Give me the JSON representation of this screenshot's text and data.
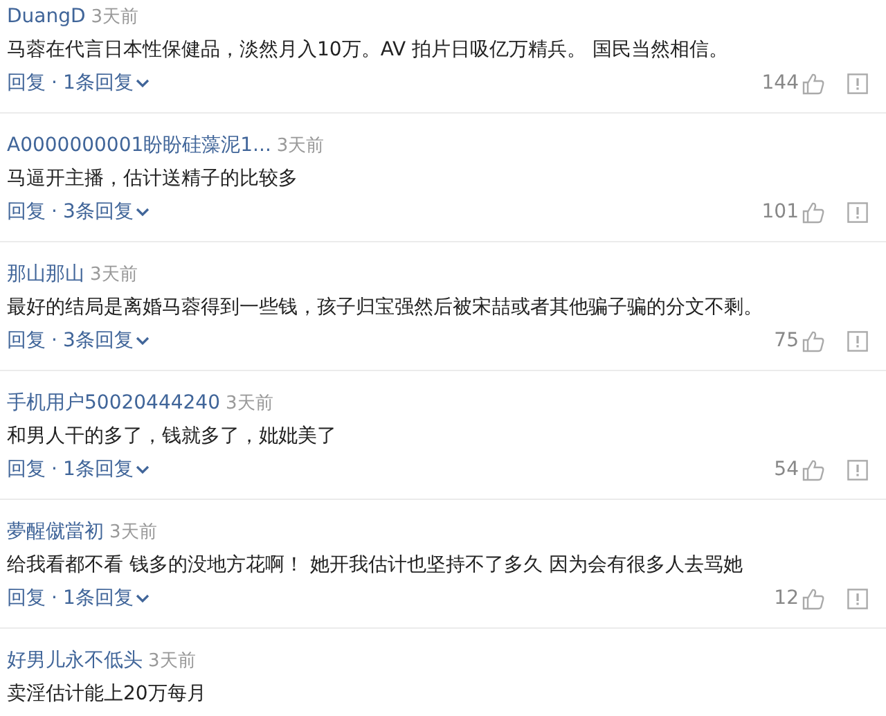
{
  "comments": [
    {
      "author": "DuangD",
      "time": "3天前",
      "text": "马蓉在代言日本性保健品，淡然月入10万。AV 拍片日吸亿万精兵。 国民当然相信。",
      "reply": "回复",
      "separator": "·",
      "replies": "1条回复",
      "likes": "144"
    },
    {
      "author": "A0000000001盼盼硅藻泥1...",
      "time": "3天前",
      "text": "马逼开主播，估计送精子的比较多",
      "reply": "回复",
      "separator": "·",
      "replies": "3条回复",
      "likes": "101"
    },
    {
      "author": "那山那山",
      "time": "3天前",
      "text": "最好的结局是离婚马蓉得到一些钱，孩子归宝强然后被宋喆或者其他骗子骗的分文不剩。",
      "reply": "回复",
      "separator": "·",
      "replies": "3条回复",
      "likes": "75"
    },
    {
      "author": "手机用户50020444240",
      "time": "3天前",
      "text": "和男人干的多了，钱就多了，妣妣美了",
      "reply": "回复",
      "separator": "·",
      "replies": "1条回复",
      "likes": "54"
    },
    {
      "author": "夢醒僦當初",
      "time": "3天前",
      "text": "给我看都不看 钱多的没地方花啊！ 她开我估计也坚持不了多久 因为会有很多人去骂她",
      "reply": "回复",
      "separator": "·",
      "replies": "1条回复",
      "likes": "12"
    },
    {
      "author": "好男儿永不低头",
      "time": "3天前",
      "text": "卖淫估计能上20万每月"
    }
  ]
}
